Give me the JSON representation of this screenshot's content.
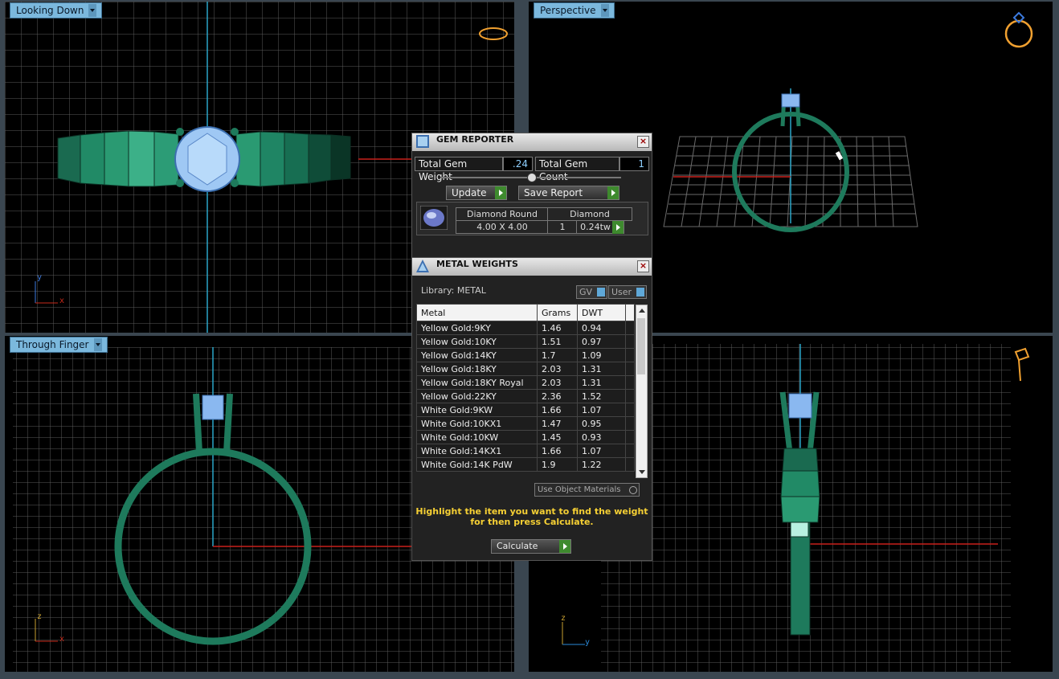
{
  "viewports": {
    "top_left": {
      "label": "Looking Down",
      "axis_a": "y",
      "axis_b": "x"
    },
    "top_right": {
      "label": "Perspective"
    },
    "bottom_left": {
      "label": "Through Finger",
      "axis_a": "z",
      "axis_b": "x"
    },
    "bottom_right": {
      "axis_a": "z",
      "axis_b": "y"
    }
  },
  "gem_reporter": {
    "title": "GEM REPORTER",
    "total_weight_label": "Total Gem Weight",
    "total_weight_value": ".24",
    "total_count_label": "Total Gem Count",
    "total_count_value": "1",
    "update_label": "Update",
    "save_label": "Save Report",
    "gem": {
      "shape": "Diamond Round",
      "material": "Diamond",
      "size": "4.00 X 4.00",
      "count": "1",
      "weight": "0.24tw"
    }
  },
  "metal_weights": {
    "title": "METAL WEIGHTS",
    "library_label": "Library: METAL",
    "gv_label": "GV",
    "user_label": "User",
    "columns": [
      "Metal",
      "Grams",
      "DWT"
    ],
    "rows": [
      [
        "Yellow Gold:9KY",
        "1.46",
        "0.94"
      ],
      [
        "Yellow Gold:10KY",
        "1.51",
        "0.97"
      ],
      [
        "Yellow Gold:14KY",
        "1.7",
        "1.09"
      ],
      [
        "Yellow Gold:18KY",
        "2.03",
        "1.31"
      ],
      [
        "Yellow Gold:18KY Royal",
        "2.03",
        "1.31"
      ],
      [
        "Yellow Gold:22KY",
        "2.36",
        "1.52"
      ],
      [
        "White Gold:9KW",
        "1.66",
        "1.07"
      ],
      [
        "White Gold:10KX1",
        "1.47",
        "0.95"
      ],
      [
        "White Gold:10KW",
        "1.45",
        "0.93"
      ],
      [
        "White Gold:14KX1",
        "1.66",
        "1.07"
      ],
      [
        "White Gold:14K PdW",
        "1.9",
        "1.22"
      ]
    ],
    "use_object_materials": "Use Object Materials",
    "hint": "Highlight the item you want to find the weight for then press Calculate.",
    "calculate_label": "Calculate"
  },
  "colors": {
    "ring": "#1e7a5c",
    "gem": "#8ab8f0",
    "grid": "#6e6e6e",
    "accent_orange": "#f0a030",
    "highlight_text": "#f6d034"
  }
}
